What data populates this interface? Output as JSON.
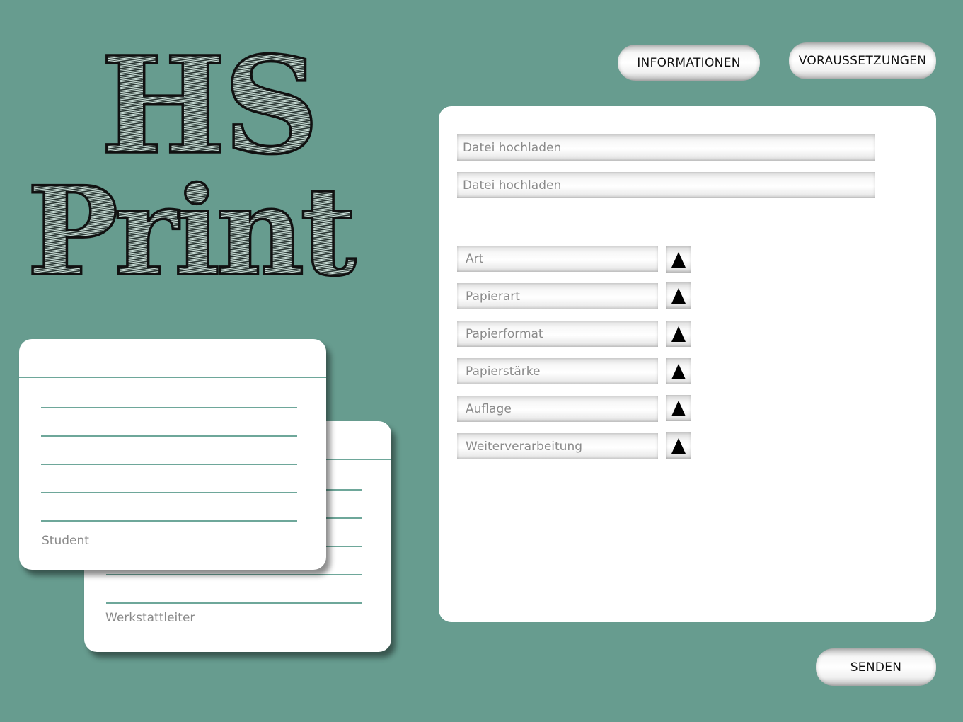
{
  "logo": {
    "line1": "HS",
    "line2": "Print"
  },
  "header": {
    "info_label": "INFORMATIONEN",
    "requirements_label": "VORAUSSETZUNGEN"
  },
  "form": {
    "uploads": [
      {
        "label": "Datei hochladen"
      },
      {
        "label": "Datei hochladen"
      }
    ],
    "options": [
      {
        "label": "Art"
      },
      {
        "label": "Papierart"
      },
      {
        "label": "Papierformat"
      },
      {
        "label": "Papierstärke"
      },
      {
        "label": "Auflage"
      },
      {
        "label": "Weiterverarbeitung"
      }
    ],
    "dropdown_icon": "triangle-up-icon"
  },
  "cards": {
    "student_label": "Student",
    "supervisor_label": "Werkstattleiter"
  },
  "footer": {
    "send_label": "SENDEN"
  },
  "colors": {
    "background": "#679c8f",
    "line": "#6ea79a",
    "panel": "#ffffff"
  }
}
